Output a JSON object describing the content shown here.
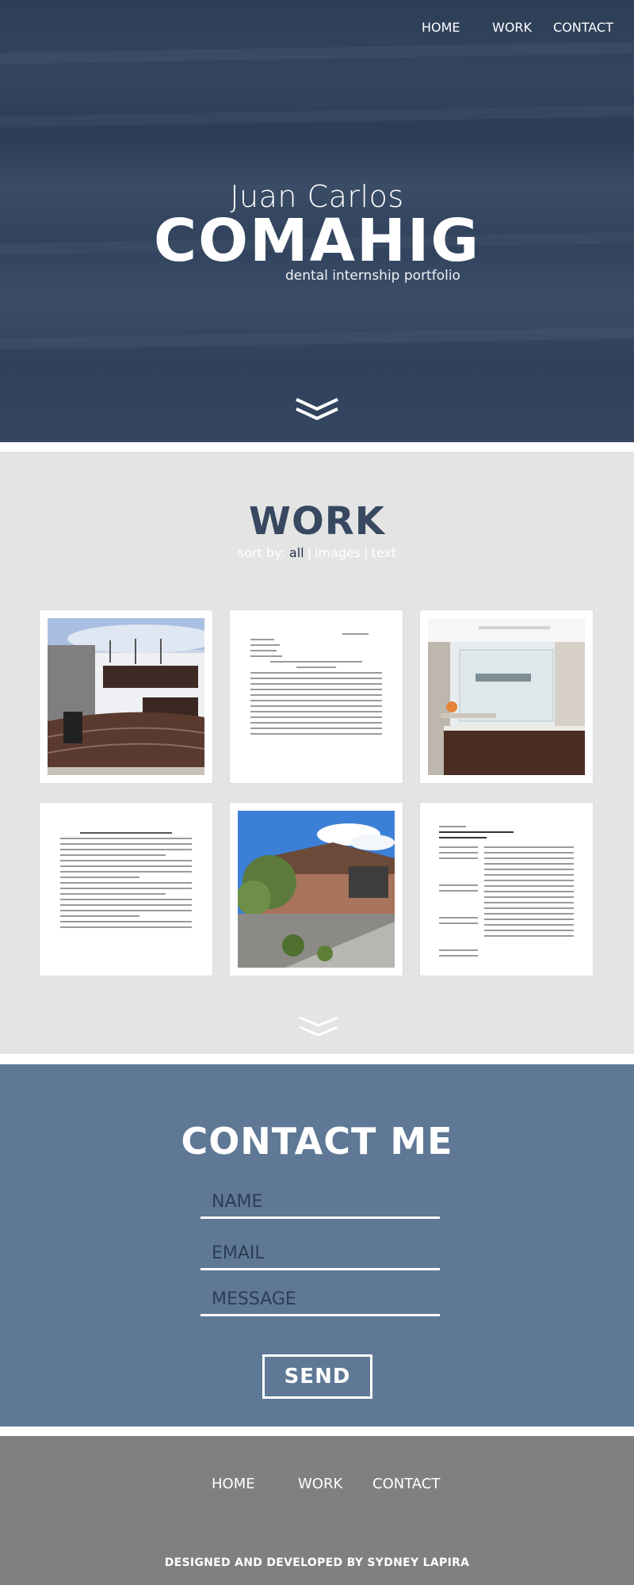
{
  "nav": {
    "home": "HOME",
    "work": "WORK",
    "contact": "CONTACT"
  },
  "hero": {
    "first_name": "Juan Carlos",
    "last_name": "COMAHIG",
    "subtitle": "dental internship portfolio"
  },
  "work": {
    "title": "WORK",
    "sort_prefix": "sort by:",
    "sort_options": [
      "all",
      "images",
      "text"
    ],
    "sort_active": "all"
  },
  "contact": {
    "title": "CONTACT ME",
    "name_placeholder": "NAME",
    "email_placeholder": "EMAIL",
    "message_placeholder": "MESSAGE",
    "send_label": "SEND"
  },
  "footer": {
    "home": "HOME",
    "work": "WORK",
    "contact": "CONTACT",
    "credit": "DESIGNED AND DEVELOPED BY SYDNEY LAPIRA"
  },
  "colors": {
    "hero_bg": "#2f415b",
    "work_bg": "#e4e4e4",
    "contact_bg": "#5f7896",
    "footer_bg": "#808080",
    "title_dark": "#374860"
  }
}
